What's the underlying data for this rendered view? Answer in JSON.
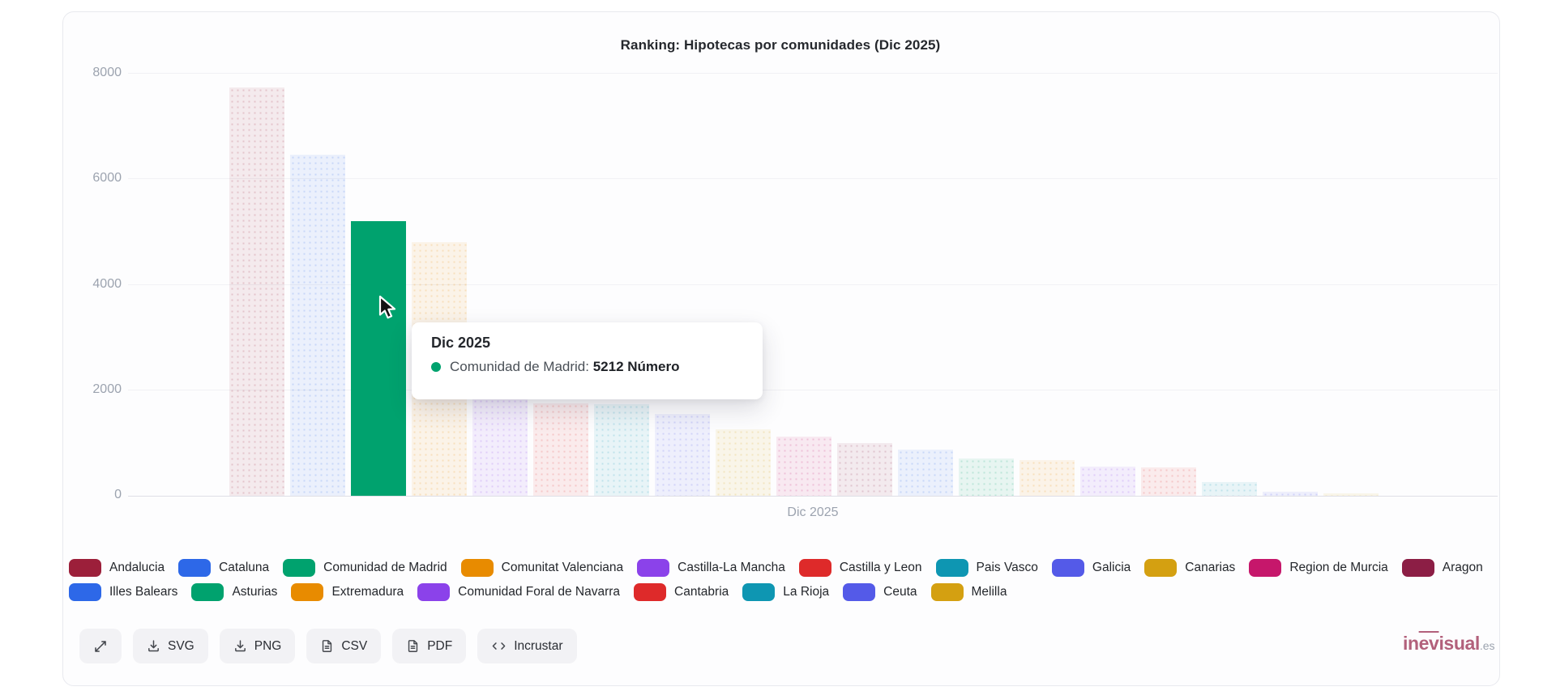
{
  "chart_data": {
    "type": "bar",
    "title": "Ranking: Hipotecas por comunidades (Dic 2025)",
    "x_categories": [
      "Dic 2025"
    ],
    "x_tick_label": "Dic 2025",
    "ylabel": "",
    "ylim": [
      0,
      8000
    ],
    "yticks": [
      0,
      2000,
      4000,
      6000,
      8000
    ],
    "unit": "Número",
    "grid": true,
    "legend_position": "bottom",
    "series": [
      {
        "name": "Andalucia",
        "value": 7740,
        "color": "#9C1F3A",
        "state": "muted"
      },
      {
        "name": "Cataluna",
        "value": 6470,
        "color": "#2D68E8",
        "state": "muted"
      },
      {
        "name": "Comunidad de Madrid",
        "value": 5212,
        "color": "#00A26E",
        "state": "active"
      },
      {
        "name": "Comunitat Valenciana",
        "value": 4800,
        "color": "#E88B00",
        "state": "muted"
      },
      {
        "name": "Castilla-La Mancha",
        "value": 1850,
        "color": "#8B42EA",
        "state": "muted"
      },
      {
        "name": "Castilla y Leon",
        "value": 1745,
        "color": "#DE2A2A",
        "state": "muted"
      },
      {
        "name": "Pais Vasco",
        "value": 1730,
        "color": "#0E96B2",
        "state": "muted"
      },
      {
        "name": "Galicia",
        "value": 1545,
        "color": "#545AE8",
        "state": "muted"
      },
      {
        "name": "Canarias",
        "value": 1255,
        "color": "#D4A011",
        "state": "muted"
      },
      {
        "name": "Region de Murcia",
        "value": 1120,
        "color": "#C6176B",
        "state": "muted"
      },
      {
        "name": "Aragon",
        "value": 995,
        "color": "#8C1E45",
        "state": "muted"
      },
      {
        "name": "Illes Balears",
        "value": 870,
        "color": "#2D68E8",
        "state": "muted"
      },
      {
        "name": "Asturias",
        "value": 700,
        "color": "#00A26E",
        "state": "muted"
      },
      {
        "name": "Extremadura",
        "value": 670,
        "color": "#E88B00",
        "state": "muted"
      },
      {
        "name": "Comunidad Foral de Navarra",
        "value": 560,
        "color": "#8B42EA",
        "state": "muted"
      },
      {
        "name": "Cantabria",
        "value": 545,
        "color": "#DE2A2A",
        "state": "muted"
      },
      {
        "name": "La Rioja",
        "value": 260,
        "color": "#0E96B2",
        "state": "muted"
      },
      {
        "name": "Ceuta",
        "value": 75,
        "color": "#545AE8",
        "state": "muted"
      },
      {
        "name": "Melilla",
        "value": 40,
        "color": "#D4A011",
        "state": "muted"
      }
    ]
  },
  "legend": {
    "rows": [
      [
        0,
        1,
        2,
        3,
        4,
        5,
        6,
        7,
        8,
        9,
        10
      ],
      [
        11,
        12,
        13,
        14,
        15,
        16,
        17,
        18
      ]
    ]
  },
  "tooltip": {
    "title": "Dic 2025",
    "series_label": "Comunidad de Madrid:",
    "value_text": "5212 Número",
    "dot_color": "#00A26E"
  },
  "toolbar": {
    "buttons": [
      {
        "name": "fullscreen-button",
        "label": "",
        "icon": "expand-icon"
      },
      {
        "name": "export-svg-button",
        "label": "SVG",
        "icon": "download-icon"
      },
      {
        "name": "export-png-button",
        "label": "PNG",
        "icon": "download-icon"
      },
      {
        "name": "export-csv-button",
        "label": "CSV",
        "icon": "file-icon"
      },
      {
        "name": "export-pdf-button",
        "label": "PDF",
        "icon": "file-icon"
      },
      {
        "name": "embed-button",
        "label": "Incrustar",
        "icon": "code-icon"
      }
    ]
  },
  "branding": {
    "logo_prefix": "in",
    "logo_overlined": "ev",
    "logo_rest": "isual",
    "logo_suffix": ".es"
  }
}
